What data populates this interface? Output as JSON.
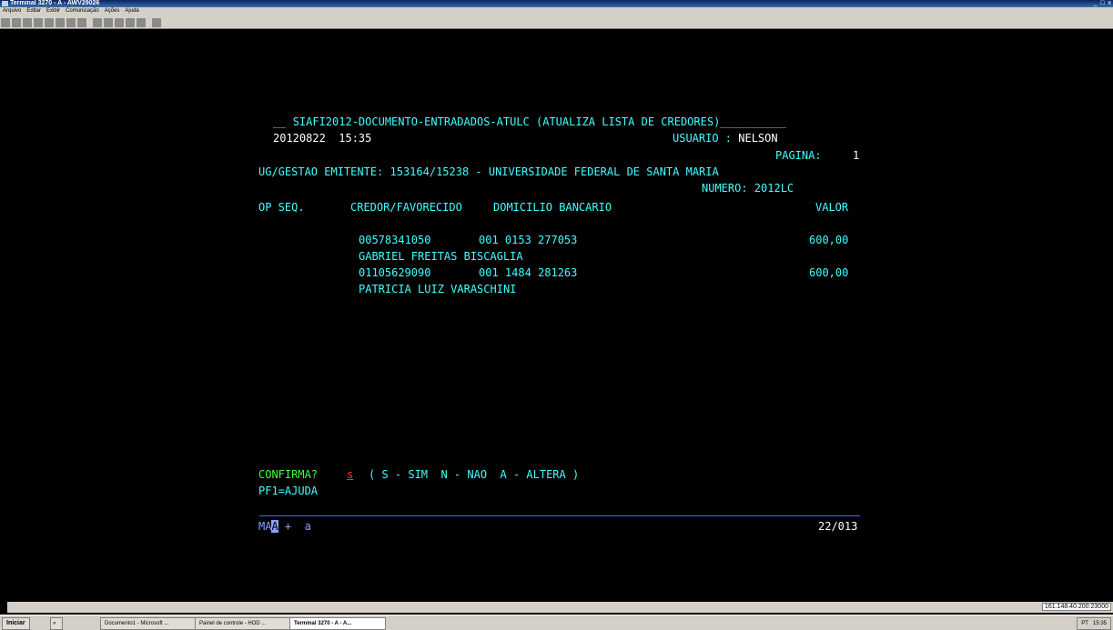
{
  "window": {
    "title": "Terminal 3270 - A - AWV29026",
    "controls": "_  □  x"
  },
  "menu": [
    "Arquivo",
    "Editar",
    "Exibir",
    "Comunicação",
    "Ações",
    "Ajuda"
  ],
  "toolbar_icons": [
    "copy-icon",
    "paste-icon",
    "print-icon",
    "send-icon",
    "receive-icon",
    "macro-icon",
    "keypad-icon",
    "map-icon",
    "color-icon",
    "display-icon",
    "tools-icon",
    "record-icon",
    "play-icon",
    "help-icon"
  ],
  "terminal": {
    "header_prefix": "__ ",
    "header": "SIAFI2012-DOCUMENTO-ENTRADADOS-ATULC (ATUALIZA LISTA DE CREDORES)",
    "header_suffix": "__________",
    "date_time": "20120822  15:35",
    "usuario_label": "USUARIO : ",
    "usuario": "NELSON",
    "pagina_label": "PAGINA:",
    "pagina": "1",
    "ug_gestao": "UG/GESTAO EMITENTE: 153164/15238 - UNIVERSIDADE FEDERAL DE SANTA MARIA",
    "numero_label": "NUMERO: ",
    "numero": "2012LC",
    "columns": [
      "OP SEQ.",
      "CREDOR/FAVORECIDO",
      "DOMICILIO BANCARIO",
      "VALOR"
    ],
    "rows": [
      {
        "credor": "00578341050",
        "domicilio": "001 0153 277053",
        "valor": "600,00",
        "nome": "GABRIEL FREITAS BISCAGLIA"
      },
      {
        "credor": "01105629090",
        "domicilio": "001 1484 281263",
        "valor": "600,00",
        "nome": "PATRICIA LUIZ VARASCHINI"
      }
    ],
    "confirma_label": "CONFIRMA?",
    "confirma_value": "s",
    "confirma_options": "( S - SIM  N - NAO  A - ALTERA )",
    "pf1": "PF1=AJUDA",
    "oia_left": "MA",
    "oia_cursor": "A",
    "oia_mid": "+  a",
    "oia_pos": "22/013"
  },
  "statusbar": {
    "host": "161.148.40.200:23000"
  },
  "taskbar": {
    "start": "Iniciar",
    "more": "»",
    "tasks": [
      "Documento1 - Microsoft ...",
      "Painel de controle - HOD ...",
      "Terminal 3270 - A - A..."
    ],
    "tray_lang": "PT",
    "tray_time": "15:35"
  },
  "colors": {
    "cyan": "#40ffff",
    "green": "#40ff40",
    "red": "#ff3333",
    "rule": "#5060ff"
  }
}
